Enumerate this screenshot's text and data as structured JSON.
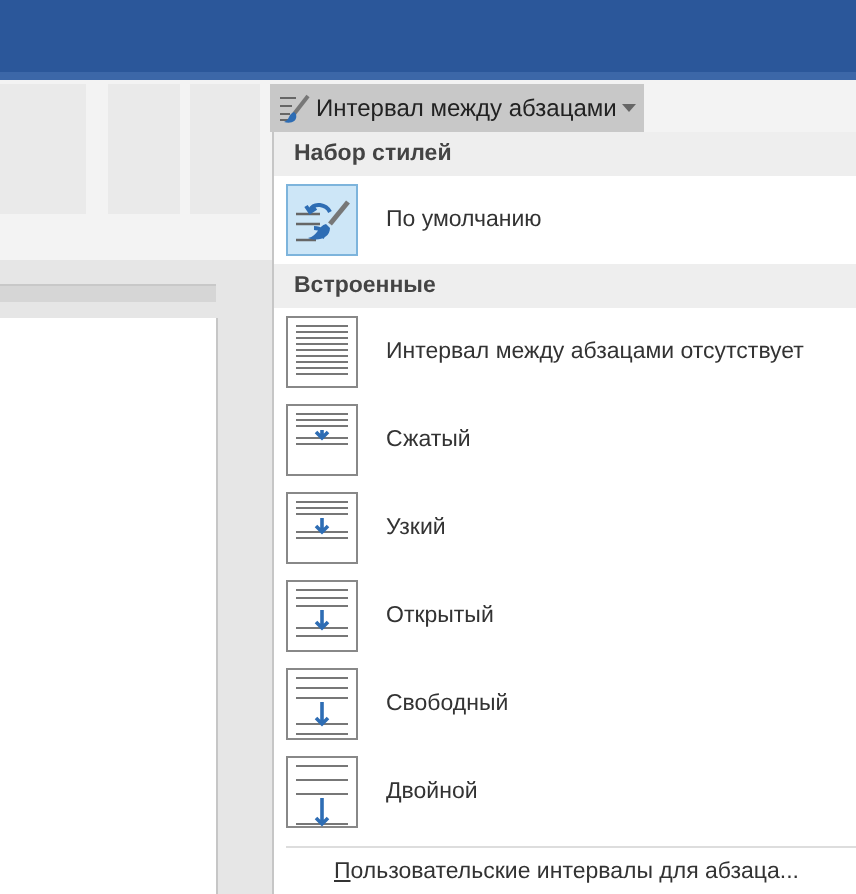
{
  "ribbon": {
    "spacing_button": {
      "label": "Интервал между абзацами",
      "expanded": true
    }
  },
  "menu": {
    "sections": [
      {
        "header": "Набор стилей",
        "items": [
          {
            "label": "По умолчанию",
            "kind": "default",
            "selected": true
          }
        ]
      },
      {
        "header": "Встроенные",
        "items": [
          {
            "label": "Интервал между абзацами отсутствует",
            "kind": "none",
            "selected": false
          },
          {
            "label": "Сжатый",
            "kind": "compact",
            "selected": false
          },
          {
            "label": "Узкий",
            "kind": "tight",
            "selected": false
          },
          {
            "label": "Открытый",
            "kind": "open",
            "selected": false
          },
          {
            "label": "Свободный",
            "kind": "relaxed",
            "selected": false
          },
          {
            "label": "Двойной",
            "kind": "double",
            "selected": false
          }
        ]
      }
    ],
    "footer": "Пользовательские интервалы для абзаца..."
  }
}
